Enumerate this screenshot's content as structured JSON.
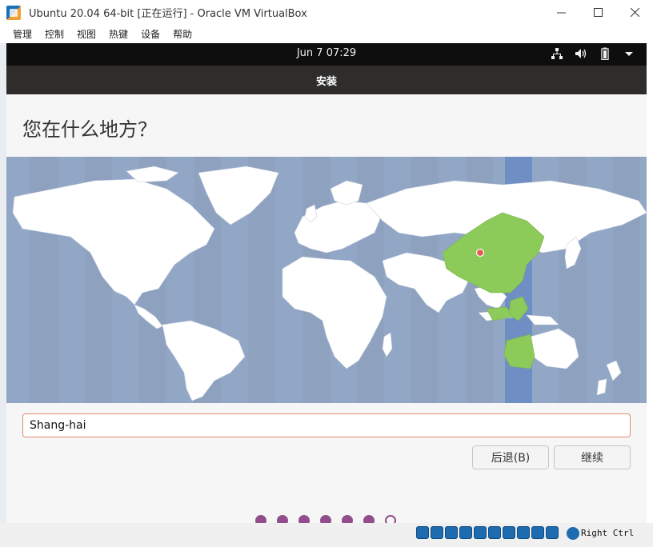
{
  "host": {
    "window_title": "Ubuntu 20.04 64-bit [正在运行] - Oracle VM VirtualBox",
    "menu": [
      "管理",
      "控制",
      "视图",
      "热键",
      "设备",
      "帮助"
    ],
    "host_key": "Right Ctrl"
  },
  "guest": {
    "clock": "Jun 7  07:29",
    "header_title": "安装",
    "page_title": "您在什么地方？",
    "timezone_input_value": "Shang-hai",
    "back_button": "后退(B)",
    "continue_button": "继续",
    "progress": {
      "total": 7,
      "current": 7
    }
  },
  "colors": {
    "ocean": "#92a7c6",
    "land": "#ffffff",
    "highlight_land": "#8cca5a",
    "highlight_band": "#6f8fc4",
    "accent_purple": "#924d8b",
    "input_border": "#e28b71",
    "topbar": "#0e0e0e",
    "headerbar": "#2e2d2c"
  },
  "icons": [
    "network-icon",
    "volume-icon",
    "battery-icon",
    "system-menu-arrow-icon"
  ]
}
